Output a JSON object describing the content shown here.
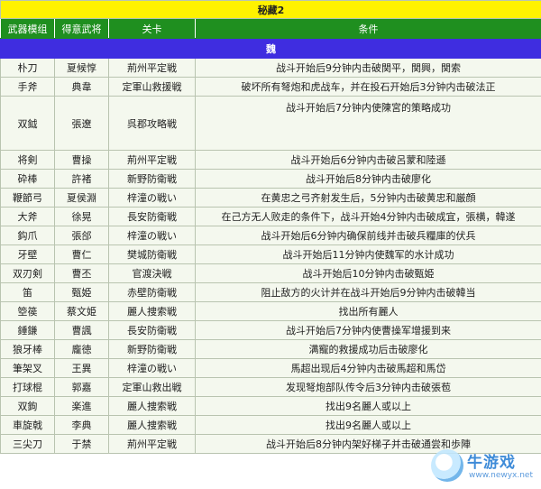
{
  "title": "秘藏2",
  "headers": [
    "武器模组",
    "得意武将",
    "关卡",
    "条件"
  ],
  "section": "魏",
  "rows": [
    {
      "weapon": "朴刀",
      "general": "夏候惇",
      "stage": "荊州平定戦",
      "condition": "战斗开始后9分钟内击破関平，関興，関索"
    },
    {
      "weapon": "手斧",
      "general": "典韋",
      "stage": "定軍山救援戦",
      "condition": "破坏所有弩炮和虎战车，并在投石开始后3分钟内击破法正"
    },
    {
      "weapon": "双鉞",
      "general": "張遼",
      "stage": "呉郡攻略戦",
      "condition": "战斗开始后7分钟内使陳宮的策略成功",
      "tall": true
    },
    {
      "weapon": "将剣",
      "general": "曹操",
      "stage": "荊州平定戦",
      "condition": "战斗开始后6分钟内击破呂蒙和陸遜"
    },
    {
      "weapon": "砕棒",
      "general": "許褚",
      "stage": "新野防衛戦",
      "condition": "战斗开始后8分钟内击破廖化"
    },
    {
      "weapon": "鞭節弓",
      "general": "夏侯淵",
      "stage": "梓潼の戦い",
      "condition": "在黄忠之弓齐射发生后，5分钟内击破黄忠和厳顔"
    },
    {
      "weapon": "大斧",
      "general": "徐晃",
      "stage": "長安防衛戦",
      "condition": "在己方无人败走的条件下，战斗开始4分钟内击破成宜，張横，韓遂"
    },
    {
      "weapon": "鈎爪",
      "general": "張郃",
      "stage": "梓潼の戦い",
      "condition": "战斗开始后6分钟内确保前线并击破兵糧庫的伏兵"
    },
    {
      "weapon": "牙壁",
      "general": "曹仁",
      "stage": "樊城防衛戦",
      "condition": "战斗开始后11分钟内使魏军的水计成功"
    },
    {
      "weapon": "双刃剣",
      "general": "曹丕",
      "stage": "官渡決戦",
      "condition": "战斗开始后10分钟内击破甄姫"
    },
    {
      "weapon": "笛",
      "general": "甄姫",
      "stage": "赤壁防衛戦",
      "condition": "阻止敌方的火计并在战斗开始后9分钟内击破韓当"
    },
    {
      "weapon": "箜篌",
      "general": "蔡文姫",
      "stage": "麗人捜索戦",
      "condition": "找出所有麗人"
    },
    {
      "weapon": "錘鎌",
      "general": "曹諷",
      "stage": "長安防衛戦",
      "condition": "战斗开始后7分钟内使曹操军增援到来"
    },
    {
      "weapon": "狼牙棒",
      "general": "龐徳",
      "stage": "新野防衛戦",
      "condition": "满寵的救援成功后击破廖化"
    },
    {
      "weapon": "筆架叉",
      "general": "王異",
      "stage": "梓潼の戦い",
      "condition": "馬超出现后4分钟内击破馬超和馬岱"
    },
    {
      "weapon": "打球棍",
      "general": "郭嘉",
      "stage": "定軍山救出戦",
      "condition": "发现弩炮部队传令后3分钟内击破張苞"
    },
    {
      "weapon": "双鉤",
      "general": "楽進",
      "stage": "麗人捜索戦",
      "condition": "找出9名麗人或以上"
    },
    {
      "weapon": "車旋戟",
      "general": "李典",
      "stage": "麗人捜索戦",
      "condition": "找出9名麗人或以上"
    },
    {
      "weapon": "三尖刀",
      "general": "于禁",
      "stage": "荊州平定戦",
      "condition": "战斗开始后8分钟内架好梯子并击破通尝和歩陣"
    }
  ],
  "watermark": {
    "brand": "牛游戏",
    "url": "www.newyx.net"
  }
}
